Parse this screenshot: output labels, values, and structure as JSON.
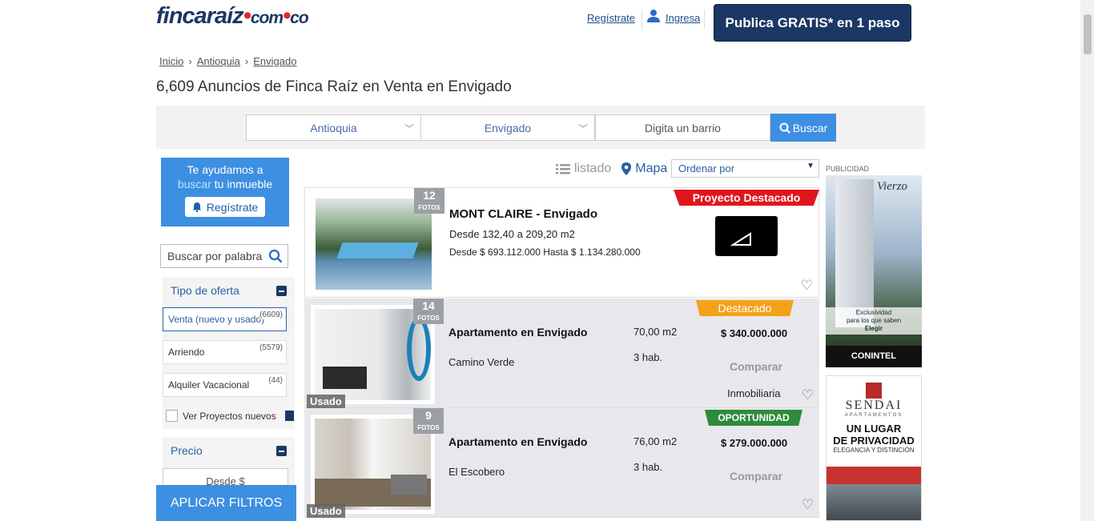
{
  "header": {
    "logo": "fincaraíz",
    "logo_domain": "com",
    "logo_country": "co",
    "register_link": "Regístrate",
    "login_link": "Ingresa",
    "publish_button": "Publica GRATIS* en 1 paso"
  },
  "breadcrumb": [
    "Inicio",
    "Antioquia",
    "Envigado"
  ],
  "page_title": "6,609 Anuncios de Finca Raíz en Venta en Envigado",
  "search": {
    "department": "Antioquia",
    "city": "Envigado",
    "neighborhood_placeholder": "Digita un barrio",
    "button": "Buscar"
  },
  "sidebar": {
    "help_line1": "Te ayudamos a",
    "help_highlight": "buscar",
    "help_line2": "tu inmueble",
    "help_button": "Regístrate",
    "keyword_placeholder": "Buscar por palabra",
    "offer_type_title": "Tipo de oferta",
    "offer_options": [
      {
        "label": "Venta (nuevo y usado)",
        "count": "(6609)"
      },
      {
        "label": "Arriendo",
        "count": "(5579)"
      },
      {
        "label": "Alquiler Vacacional",
        "count": "(44)"
      }
    ],
    "projects_label": "Ver Proyectos nuevos",
    "price_title": "Precio",
    "price_from_placeholder": "Desde $",
    "apply_button": "APLICAR FILTROS"
  },
  "view": {
    "list_label": "listado",
    "map_label": "Mapa",
    "order_label": "Ordenar por"
  },
  "listings": [
    {
      "badge": "Proyecto Destacado",
      "badge_color": "#e0161c",
      "photos": "12",
      "photos_label": "FOTOS",
      "title": "MONT CLAIRE - Envigado",
      "line1": "Desde 132,40 a 209,20 m2",
      "line2": "Desde $ 693.112.000 Hasta $ 1.134.280.000"
    },
    {
      "badge": "Destacado",
      "badge_color": "#f4a11a",
      "photos": "14",
      "photos_label": "FOTOS",
      "condition": "Usado",
      "title": "Apartamento en Envigado",
      "area": "70,00 m2",
      "price": "$ 340.000.000",
      "neighborhood": "Camino Verde",
      "rooms": "3 hab.",
      "compare": "Comparar",
      "seller": "Inmobiliaria"
    },
    {
      "badge": "OPORTUNIDAD",
      "badge_color": "#2e8b3c",
      "photos": "9",
      "photos_label": "FOTOS",
      "condition": "Usado",
      "title": "Apartamento en Envigado",
      "area": "76,00 m2",
      "price": "$ 279.000.000",
      "neighborhood": "El Escobero",
      "rooms": "3 hab.",
      "compare": "Comparar"
    }
  ],
  "ads": {
    "label": "PUBLICIDAD",
    "ad1_brand": "Vierzo",
    "ad1_line1": "Exclusividad",
    "ad1_line2": "para los que saben",
    "ad1_line3": "Elegir",
    "ad1_footer": "CONINTEL",
    "ad2_brand": "SENDAI",
    "ad2_sub": "APARTAMENTOS",
    "ad2_line1": "UN LUGAR",
    "ad2_line2": "DE PRIVACIDAD",
    "ad2_line3": "ELEGANCIA Y DISTINCIÓN"
  },
  "colors": {
    "brand_navy": "#1b3765",
    "accent_blue": "#3d8fe1",
    "logo_red": "#e0282c"
  }
}
